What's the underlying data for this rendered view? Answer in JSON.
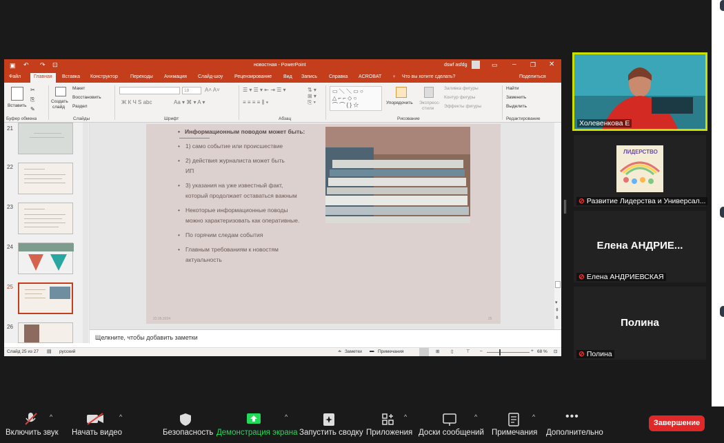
{
  "app_window": {
    "title": "новостная - PowerPoint",
    "user": "dswf asfdg"
  },
  "ppt_tabs": [
    "Файл",
    "Главная",
    "Вставка",
    "Конструктор",
    "Переходы",
    "Анимация",
    "Слайд-шоу",
    "Рецензирование",
    "Вид",
    "Запись",
    "Справка",
    "ACROBAT",
    "Что вы хотите сделать?",
    "Поделиться"
  ],
  "ribbon": {
    "groups": [
      "Буфер обмена",
      "Слайды",
      "Шрифт",
      "Абзац",
      "Рисование",
      "Редактирование"
    ],
    "paste": "Вставить",
    "new_slide_1": "Создать",
    "new_slide_2": "слайд",
    "layout": "Макет",
    "reset": "Восстановить",
    "section": "Раздел",
    "font_size": "18",
    "arrange": "Упорядочить",
    "quick_styles_1": "Экспресс-",
    "quick_styles_2": "стили",
    "fill": "Заливка фигуры",
    "outline": "Контур фигуры",
    "effects": "Эффекты фигуры",
    "find": "Найти",
    "replace": "Заменить",
    "select": "Выделить"
  },
  "thumbnails": [
    {
      "num": "21"
    },
    {
      "num": "22"
    },
    {
      "num": "23"
    },
    {
      "num": "24",
      "title": "Строение новости - перевёрнутая пирамида"
    },
    {
      "num": "25"
    },
    {
      "num": "26"
    }
  ],
  "slide": {
    "heading": "Информационным поводом может быть:",
    "items": [
      "1)          само событие или происшествие",
      "2)          действия журналиста может быть",
      "ИП",
      "3)          указания на уже известный факт,",
      "который продолжает оставаться важным",
      "Некоторые информационные поводы",
      "можно характеризовать как оперативные.",
      "По горячим следам события",
      "Главным требованиям к новостям",
      "актуальность"
    ],
    "date": "22.05.2024",
    "page": "25"
  },
  "notes_placeholder": "Щелкните, чтобы добавить заметки",
  "status_bar": {
    "slide": "Слайд 25 из 27",
    "lang": "русский",
    "notes": "Заметки",
    "comments": "Примечания",
    "zoom": "68 %"
  },
  "participants": [
    {
      "name": "Холевенкова Е",
      "muted": false
    },
    {
      "name": "Развитие Лидерства и Универсал...",
      "muted": true,
      "poster": "ЛИДЕРСТВО"
    },
    {
      "name": "Елена АНДРИЕВСКАЯ",
      "display": "Елена  АНДРИЕ...",
      "muted": true
    },
    {
      "name": "Полина",
      "display": "Полина",
      "muted": true
    }
  ],
  "toolbar": [
    "Включить звук",
    "Начать видео",
    "Безопасность",
    "Демонстрация экрана",
    "Запустить сводку",
    "Приложения",
    "Доски сообщений",
    "Примечания",
    "Дополнительно"
  ],
  "end_button": "Завершение",
  "colors": {
    "ppt_accent": "#c43e1c",
    "share_green": "#23d959",
    "end_red": "#e02828",
    "speaker_frame": "#cbe000"
  }
}
